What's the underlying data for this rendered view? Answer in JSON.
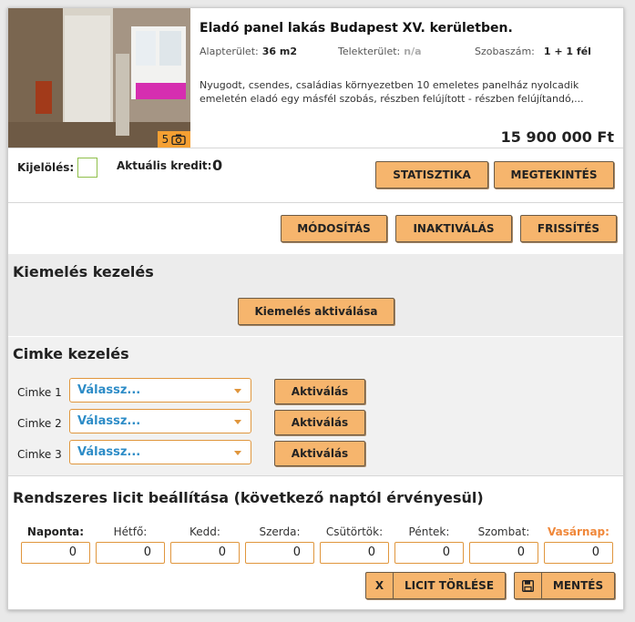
{
  "listing": {
    "photo_count": "5",
    "title": "Eladó panel lakás Budapest XV. kerületben.",
    "area_label": "Alapterület:",
    "area_value": "36 m2",
    "plot_label": "Telekterület:",
    "plot_value": "n/a",
    "rooms_label": "Szobaszám:",
    "rooms_value": "1 + 1 fél",
    "description": "Nyugodt, csendes, családias környezetben 10 emeletes panelház nyolcadik emeletén eladó egy másfél szobás, részben felújított - részben felújítandó,...",
    "price": "15 900 000 Ft"
  },
  "actions": {
    "select_label": "Kijelölés:",
    "credit_label": "Aktuális kredit:",
    "credit_value": "0",
    "statistics": "STATISZTIKA",
    "view": "MEGTEKINTÉS",
    "modify": "MÓDOSÍTÁS",
    "deactivate": "INAKTIVÁLÁS",
    "refresh": "FRISSÍTÉS"
  },
  "highlight": {
    "title": "Kiemelés kezelés",
    "activate": "Kiemelés aktiválása"
  },
  "tags": {
    "title": "Cimke kezelés",
    "rows": [
      {
        "label": "Cimke 1",
        "value": "Válassz...",
        "button": "Aktiválás"
      },
      {
        "label": "Cimke 2",
        "value": "Válassz...",
        "button": "Aktiválás"
      },
      {
        "label": "Cimke 3",
        "value": "Válassz...",
        "button": "Aktiválás"
      }
    ]
  },
  "bidding": {
    "title": "Rendszeres licit beállítása (következő naptól érvényesül)",
    "days": [
      {
        "label": "Naponta:",
        "value": "0"
      },
      {
        "label": "Hétfő:",
        "value": "0"
      },
      {
        "label": "Kedd:",
        "value": "0"
      },
      {
        "label": "Szerda:",
        "value": "0"
      },
      {
        "label": "Csütörtök:",
        "value": "0"
      },
      {
        "label": "Péntek:",
        "value": "0"
      },
      {
        "label": "Szombat:",
        "value": "0"
      },
      {
        "label": "Vasárnap:",
        "value": "0"
      }
    ],
    "delete_icon": "X",
    "delete": "LICIT TÖRLÉSE",
    "save": "MENTÉS"
  },
  "colors": {
    "button": "#f6b56d",
    "badge": "#f5a033",
    "dropdown_text": "#2d8cc7",
    "sunday": "#f0883a"
  }
}
